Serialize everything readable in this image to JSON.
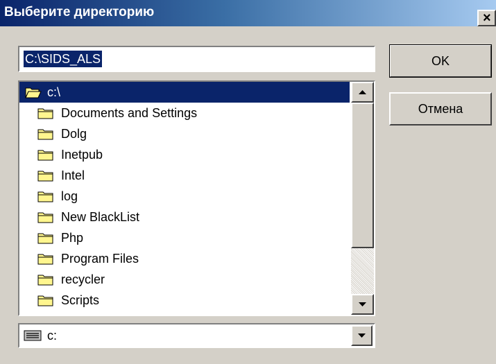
{
  "window": {
    "title": "Выберите директорию",
    "close_glyph": "×",
    "titlebar_colors": [
      "#0a246a",
      "#a6caf0"
    ]
  },
  "path_field": {
    "value": "C:\\SIDS_ALS"
  },
  "buttons": {
    "ok_label": "OK",
    "cancel_label": "Отмена"
  },
  "folder_list": {
    "root": {
      "label": "c:\\",
      "icon": "open-folder-icon"
    },
    "items": [
      {
        "label": "Documents and Settings",
        "icon": "folder-icon"
      },
      {
        "label": "Dolg",
        "icon": "folder-icon"
      },
      {
        "label": "Inetpub",
        "icon": "folder-icon"
      },
      {
        "label": "Intel",
        "icon": "folder-icon"
      },
      {
        "label": "log",
        "icon": "folder-icon"
      },
      {
        "label": "New BlackList",
        "icon": "folder-icon"
      },
      {
        "label": "Php",
        "icon": "folder-icon"
      },
      {
        "label": "Program Files",
        "icon": "folder-icon"
      },
      {
        "label": "recycler",
        "icon": "folder-icon"
      },
      {
        "label": "Scripts",
        "icon": "folder-icon"
      }
    ],
    "scroll_position": 0
  },
  "drive_select": {
    "value": "c:",
    "icon": "drive-icon"
  },
  "colors": {
    "dialog_face": "#d4d0c8",
    "selection": "#0a246a",
    "folder_fill": "#fff68f"
  }
}
